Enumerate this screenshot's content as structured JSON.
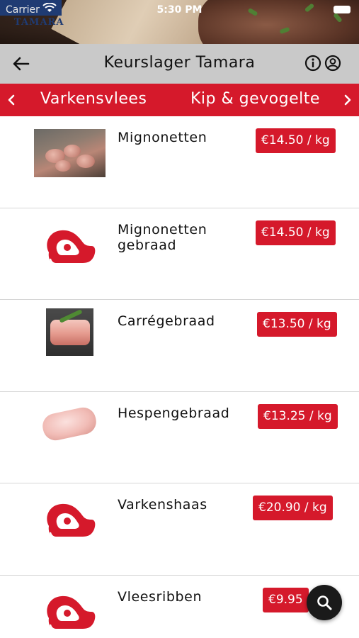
{
  "status_bar": {
    "carrier": "Carrier",
    "time": "5:30 PM"
  },
  "hero": {
    "logo_text": "TAMARA"
  },
  "navbar": {
    "title": "Keurslager Tamara",
    "icons": [
      "arrow-left-icon",
      "info-icon",
      "user-icon"
    ]
  },
  "categories": {
    "items": [
      "Varkensvlees",
      "Kip & gevogelte"
    ],
    "accent_color": "#d5192b"
  },
  "products": [
    {
      "name": "Mignonetten",
      "price": "€14.50 / kg",
      "image": "photo"
    },
    {
      "name": "Mignonetten gebraad",
      "price": "€14.50 / kg",
      "image": "steak-icon"
    },
    {
      "name": "Carrégebraad",
      "price": "€13.50 / kg",
      "image": "photo"
    },
    {
      "name": "Hespengebraad",
      "price": "€13.25 / kg",
      "image": "photo"
    },
    {
      "name": "Varkenshaas",
      "price": "€20.90 / kg",
      "image": "steak-icon"
    },
    {
      "name": "Vleesribben",
      "price": "€9.95",
      "image": "steak-icon"
    }
  ],
  "fab": {
    "icon": "search-icon"
  }
}
